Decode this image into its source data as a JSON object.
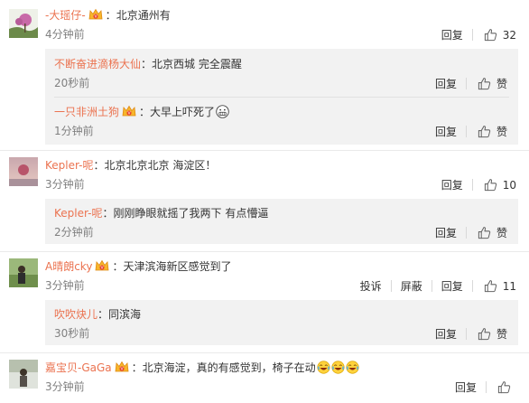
{
  "labels": {
    "reply": "回复",
    "report": "投诉",
    "block": "屏蔽",
    "like_text": "赞"
  },
  "comments": [
    {
      "user": "-大瑶仔-",
      "text": "北京通州有",
      "time": "4分钟前",
      "likes": "32",
      "replies": [
        {
          "user": "不断奋进滴杨大仙",
          "text": "北京西城 完全震醒",
          "time": "20秒前"
        },
        {
          "user": "一只非洲土狗",
          "text": "大早上吓死了",
          "time": "1分钟前"
        }
      ]
    },
    {
      "user": "Kepler-呢",
      "text": "北京北京北京 海淀区！",
      "time": "3分钟前",
      "likes": "10",
      "replies": [
        {
          "user": "Kepler-呢",
          "text": "刚刚睁眼就摇了我两下 有点懵逼",
          "time": "2分钟前"
        }
      ]
    },
    {
      "user": "A晴朗cky",
      "text": "天津滨海新区感觉到了",
      "time": "3分钟前",
      "likes": "11",
      "replies": [
        {
          "user": "吹吹炔儿",
          "text": "同滨海",
          "time": "30秒前"
        }
      ]
    },
    {
      "user": "嘉宝贝-GaGa",
      "text": "北京海淀，真的有感觉到，椅子在动",
      "time": "3分钟前",
      "likes": ""
    }
  ],
  "colors": {
    "username": "#eb7350",
    "reply_bg": "#f2f2f2",
    "time": "#808080"
  }
}
